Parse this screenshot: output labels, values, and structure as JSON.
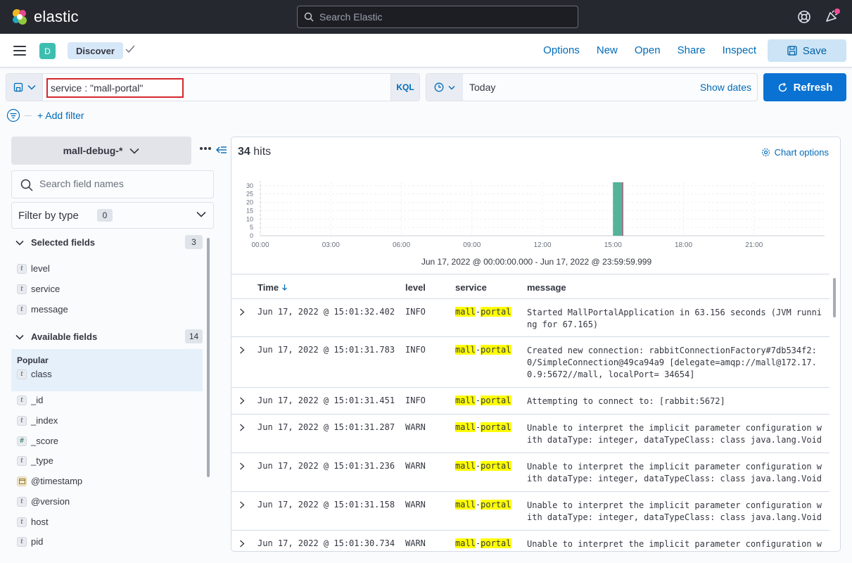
{
  "topbar": {
    "brand": "elastic",
    "search_placeholder": "Search Elastic"
  },
  "appbar": {
    "space_initial": "D",
    "app_name": "Discover",
    "links": [
      "Options",
      "New",
      "Open",
      "Share",
      "Inspect"
    ],
    "save_label": "Save"
  },
  "query": {
    "value": "service : \"mall-portal\"",
    "language": "KQL"
  },
  "date": {
    "value": "Today",
    "show_dates_label": "Show dates"
  },
  "refresh_label": "Refresh",
  "add_filter_label": "+ Add filter",
  "sidebar": {
    "index_pattern": "mall-debug-*",
    "search_placeholder": "Search field names",
    "filter_by_type_label": "Filter by type",
    "filter_by_type_count": "0",
    "selected_label": "Selected fields",
    "selected_count": "3",
    "selected_fields": [
      {
        "type": "t",
        "name": "level"
      },
      {
        "type": "t",
        "name": "service"
      },
      {
        "type": "t",
        "name": "message"
      }
    ],
    "available_label": "Available fields",
    "available_count": "14",
    "popular_label": "Popular",
    "popular_fields": [
      {
        "type": "t",
        "name": "class"
      }
    ],
    "available_fields": [
      {
        "type": "t",
        "name": "_id"
      },
      {
        "type": "t",
        "name": "_index"
      },
      {
        "type": "#",
        "name": "_score"
      },
      {
        "type": "t",
        "name": "_type"
      },
      {
        "type": "date",
        "name": "@timestamp"
      },
      {
        "type": "t",
        "name": "@version"
      },
      {
        "type": "t",
        "name": "host"
      },
      {
        "type": "t",
        "name": "pid"
      }
    ]
  },
  "main": {
    "hits_count": "34",
    "hits_label": "hits",
    "chart_options_label": "Chart options",
    "time_range": "Jun 17, 2022 @ 00:00:00.000 - Jun 17, 2022 @ 23:59:59.999",
    "columns": [
      "Time",
      "level",
      "service",
      "message"
    ],
    "rows": [
      {
        "time": "Jun 17, 2022 @ 15:01:32.402",
        "level": "INFO",
        "service_a": "mall",
        "service_b": "-",
        "service_c": "portal",
        "message": "Started MallPortalApplication in 63.156 seconds (JVM running for 67.165)"
      },
      {
        "time": "Jun 17, 2022 @ 15:01:31.783",
        "level": "INFO",
        "service_a": "mall",
        "service_b": "-",
        "service_c": "portal",
        "message": "Created new connection: rabbitConnectionFactory#7db534f2:0/SimpleConnection@49ca94a9 [delegate=amqp://mall@172.17.0.9:5672//mall, localPort= 34654]"
      },
      {
        "time": "Jun 17, 2022 @ 15:01:31.451",
        "level": "INFO",
        "service_a": "mall",
        "service_b": "-",
        "service_c": "portal",
        "message": "Attempting to connect to: [rabbit:5672]"
      },
      {
        "time": "Jun 17, 2022 @ 15:01:31.287",
        "level": "WARN",
        "service_a": "mall",
        "service_b": "-",
        "service_c": "portal",
        "message": "Unable to interpret the implicit parameter configuration with dataType: integer, dataTypeClass: class java.lang.Void"
      },
      {
        "time": "Jun 17, 2022 @ 15:01:31.236",
        "level": "WARN",
        "service_a": "mall",
        "service_b": "-",
        "service_c": "portal",
        "message": "Unable to interpret the implicit parameter configuration with dataType: integer, dataTypeClass: class java.lang.Void"
      },
      {
        "time": "Jun 17, 2022 @ 15:01:31.158",
        "level": "WARN",
        "service_a": "mall",
        "service_b": "-",
        "service_c": "portal",
        "message": "Unable to interpret the implicit parameter configuration with dataType: integer, dataTypeClass: class java.lang.Void"
      },
      {
        "time": "Jun 17, 2022 @ 15:01:30.734",
        "level": "WARN",
        "service_a": "mall",
        "service_b": "-",
        "service_c": "portal",
        "message": "Unable to interpret the implicit parameter configuration w"
      }
    ]
  },
  "chart_data": {
    "type": "bar",
    "x_ticks": [
      "00:00",
      "03:00",
      "06:00",
      "09:00",
      "12:00",
      "15:00",
      "18:00",
      "21:00"
    ],
    "y_ticks": [
      "30",
      "25",
      "20",
      "15",
      "10",
      "5",
      "0"
    ],
    "ylim": [
      0,
      32
    ],
    "xlim_hours": [
      0,
      24
    ],
    "bars": [
      {
        "hour": 15.0,
        "value": 34
      }
    ]
  },
  "colors": {
    "accent": "#0a72d2",
    "bar": "#54b399",
    "highlight": "#fefe00"
  }
}
